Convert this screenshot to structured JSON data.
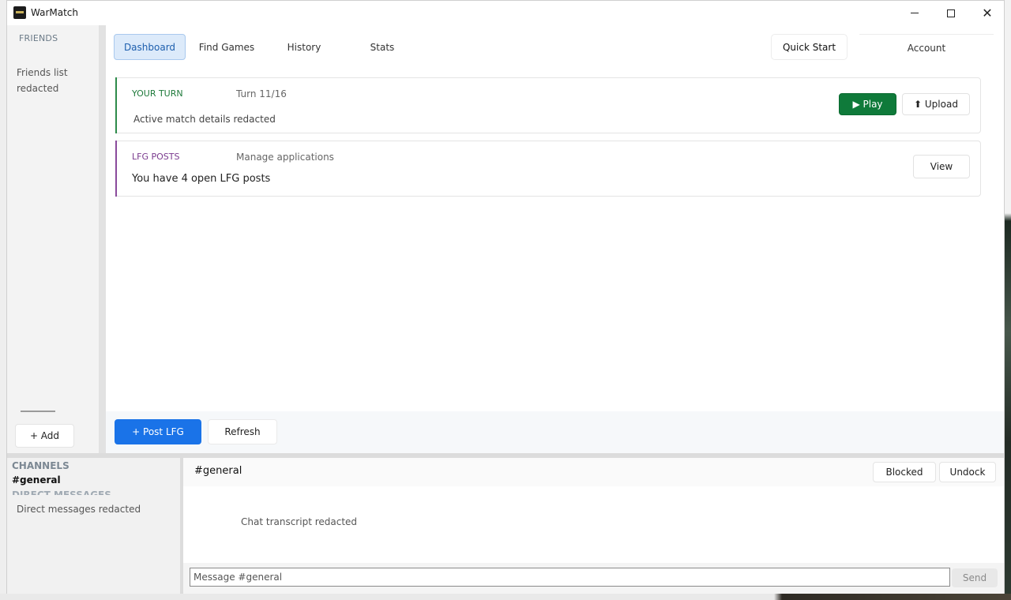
{
  "app": {
    "title": "WarMatch"
  },
  "window_controls": {
    "minimize": "minimize",
    "maximize": "maximize",
    "close": "✕"
  },
  "friends": {
    "header": "FRIENDS",
    "list_text": "Friends list redacted",
    "add_label": "+ Add"
  },
  "tabs": [
    {
      "label": "Dashboard",
      "active": true
    },
    {
      "label": "Find Games",
      "active": false
    },
    {
      "label": "History",
      "active": false
    },
    {
      "label": "Stats",
      "active": false
    }
  ],
  "header_actions": {
    "quick_start": "Quick Start",
    "account": "Account"
  },
  "cards": {
    "turn": {
      "label": "YOUR TURN",
      "sub": "Turn 11/16",
      "detail": "Active match details redacted",
      "play_label": "▶ Play",
      "upload_label": "⬆ Upload"
    },
    "lfg": {
      "label": "LFG POSTS",
      "sub": "Manage applications",
      "detail": "You have 4 open LFG posts",
      "view_label": "View"
    }
  },
  "actions": {
    "post_lfg": "+ Post LFG",
    "refresh": "Refresh"
  },
  "channels": {
    "header": "CHANNELS",
    "items": [
      "#general"
    ],
    "dm_header": "DIRECT MESSAGES",
    "dm_text": "Direct messages redacted"
  },
  "chat": {
    "title": "#general",
    "blocked_label": "Blocked",
    "undock_label": "Undock",
    "transcript": "Chat transcript redacted",
    "input_placeholder": "Message #general",
    "send_label": "Send"
  },
  "colors": {
    "accent_blue": "#1a73e8",
    "play_green": "#0f7a3a",
    "turn_accent": "#2e8b4a",
    "lfg_accent": "#8a4a9c"
  }
}
